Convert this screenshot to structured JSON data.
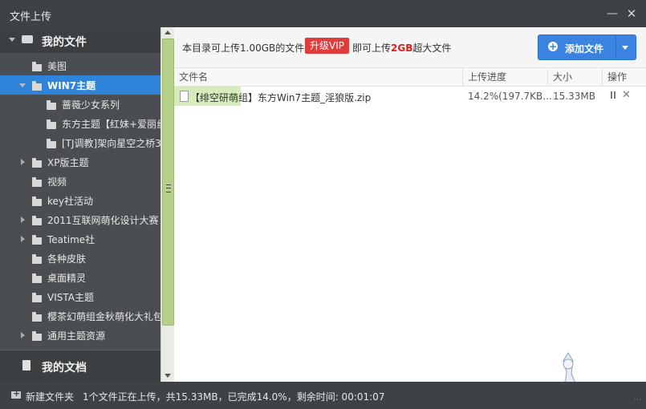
{
  "window": {
    "title": "文件上传"
  },
  "sidebar": {
    "section_files": "我的文件",
    "section_docs": "我的文档",
    "items": [
      {
        "label": "美图",
        "level": 1,
        "expandable": false,
        "selected": false
      },
      {
        "label": "WIN7主题",
        "level": 1,
        "expandable": true,
        "expanded": true,
        "selected": true
      },
      {
        "label": "蔷薇少女系列",
        "level": 2,
        "expandable": false,
        "selected": false
      },
      {
        "label": "东方主题【红妹+爱丽丝",
        "level": 2,
        "expandable": false,
        "selected": false
      },
      {
        "label": "[TJ调教]架向星空之桥3",
        "level": 2,
        "expandable": false,
        "selected": false
      },
      {
        "label": "XP版主题",
        "level": 1,
        "expandable": true,
        "selected": false
      },
      {
        "label": "视频",
        "level": 1,
        "expandable": false,
        "selected": false
      },
      {
        "label": "key社活动",
        "level": 1,
        "expandable": false,
        "selected": false
      },
      {
        "label": "2011互联网萌化设计大赛",
        "level": 1,
        "expandable": true,
        "selected": false
      },
      {
        "label": "Teatime社",
        "level": 1,
        "expandable": true,
        "selected": false
      },
      {
        "label": "各种皮肤",
        "level": 1,
        "expandable": false,
        "selected": false
      },
      {
        "label": "桌面精灵",
        "level": 1,
        "expandable": false,
        "selected": false
      },
      {
        "label": "VISTA主题",
        "level": 1,
        "expandable": false,
        "selected": false
      },
      {
        "label": "樱茶幻萌组金秋萌化大礼包",
        "level": 1,
        "expandable": false,
        "selected": false
      },
      {
        "label": "通用主题资源",
        "level": 1,
        "expandable": true,
        "selected": false
      }
    ]
  },
  "infobar": {
    "text_before": "本目录可上传1.00GB的文件,",
    "vip_button": "升级VIP",
    "text_after_prefix": "即可上传",
    "highlight": "2GB",
    "text_after_suffix": "超大文件"
  },
  "toolbar": {
    "add_file_label": "添加文件"
  },
  "table": {
    "headers": {
      "name": "文件名",
      "progress": "上传进度",
      "size": "大小",
      "ops": "操作"
    },
    "rows": [
      {
        "name": "【绯空研萌组】东方Win7主题_淫狼版.zip",
        "progress_text": "14.2%(197.7KB...",
        "progress_fraction": 0.142,
        "size": "15.33MB"
      }
    ]
  },
  "statusbar": {
    "new_folder": "新建文件夹",
    "status": "1个文件正在上传，共15.33MB，已完成14.0%，剩余时间: 00:01:07"
  },
  "colors": {
    "accent": "#3a83e0",
    "vip": "#e23b3b",
    "selected": "#2e84d8",
    "progress": "#d7ecbd"
  }
}
